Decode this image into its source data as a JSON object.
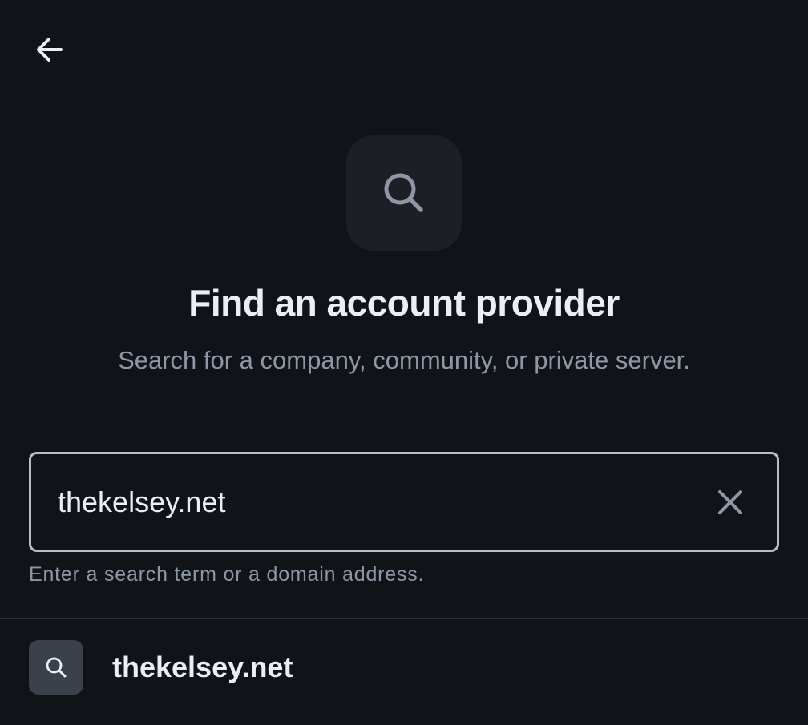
{
  "header": {
    "back_icon": "arrow-left-icon"
  },
  "hero": {
    "icon": "search-icon",
    "title": "Find an account provider",
    "subtitle": "Search for a company, community, or private server."
  },
  "search": {
    "value": "thekelsey.net",
    "clear_icon": "close-icon",
    "helper_text": "Enter a search term or a domain address."
  },
  "results": [
    {
      "icon": "search-icon",
      "label": "thekelsey.net"
    }
  ],
  "colors": {
    "background": "#101318",
    "tile": "#1d1f25",
    "primary_text": "#ebeef2",
    "secondary_text": "#8d97a5",
    "field_border": "#b8bec7",
    "result_icon_bg": "#3b414b"
  }
}
